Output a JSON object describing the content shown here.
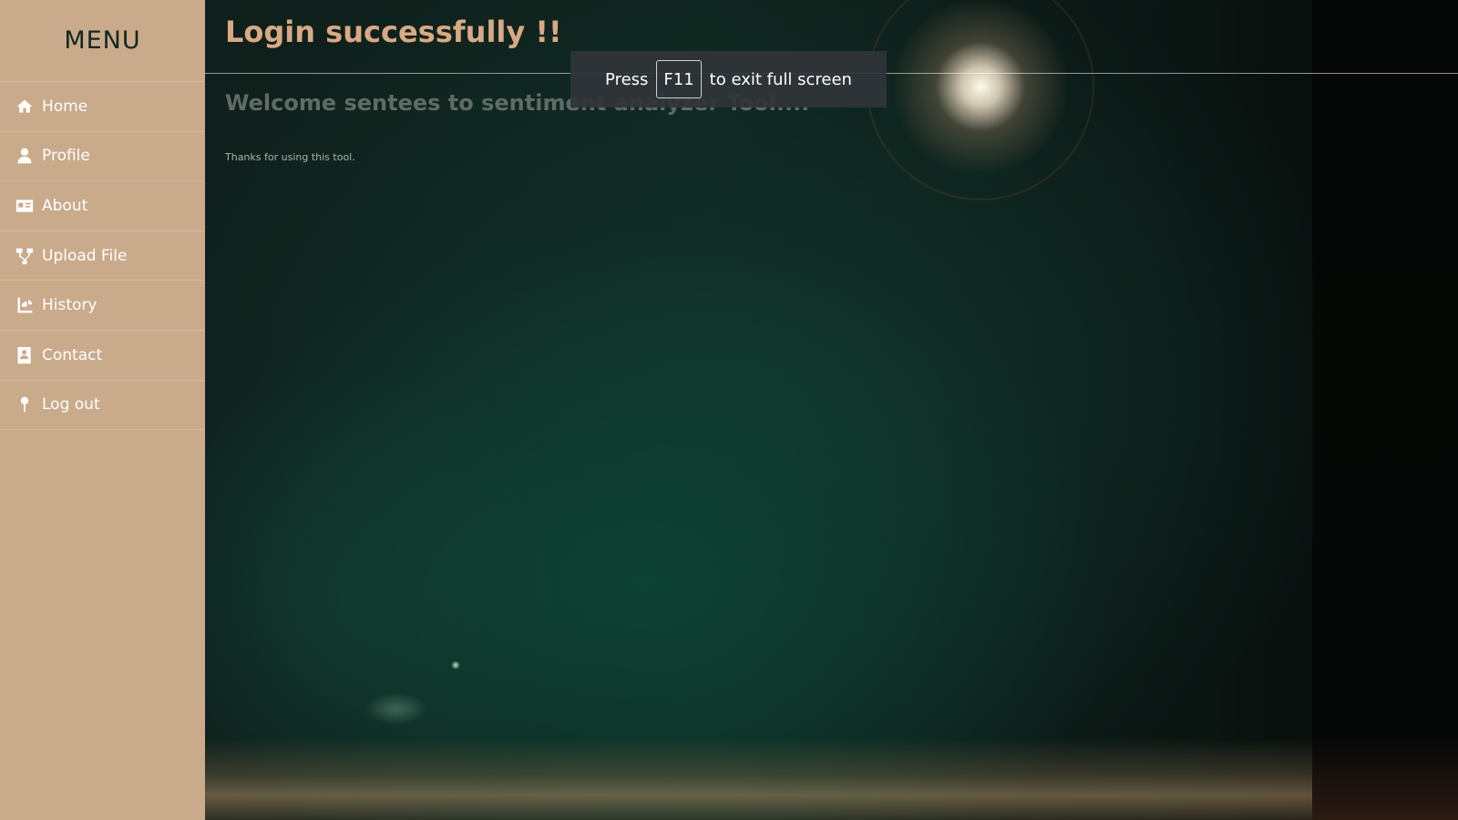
{
  "sidebar": {
    "title": "MENU",
    "items": [
      {
        "label": "Home",
        "icon": "home-icon"
      },
      {
        "label": "Profile",
        "icon": "user-icon"
      },
      {
        "label": "About",
        "icon": "id-card-icon"
      },
      {
        "label": "Upload File",
        "icon": "sitemap-icon"
      },
      {
        "label": "History",
        "icon": "history-chart-icon"
      },
      {
        "label": "Contact",
        "icon": "address-book-icon"
      },
      {
        "label": "Log out",
        "icon": "pin-icon"
      }
    ]
  },
  "main": {
    "title": "Login successfully !!",
    "welcome": "Welcome sentees to sentiment analyzer Tool....",
    "thanks": "Thanks for using this tool."
  },
  "fullscreen_notice": {
    "prefix": "Press",
    "key": "F11",
    "suffix": "to exit full screen"
  },
  "colors": {
    "sidebar_bg": "#c9aa8b",
    "title_color": "#d9a984",
    "menu_title_color": "#13261f"
  }
}
